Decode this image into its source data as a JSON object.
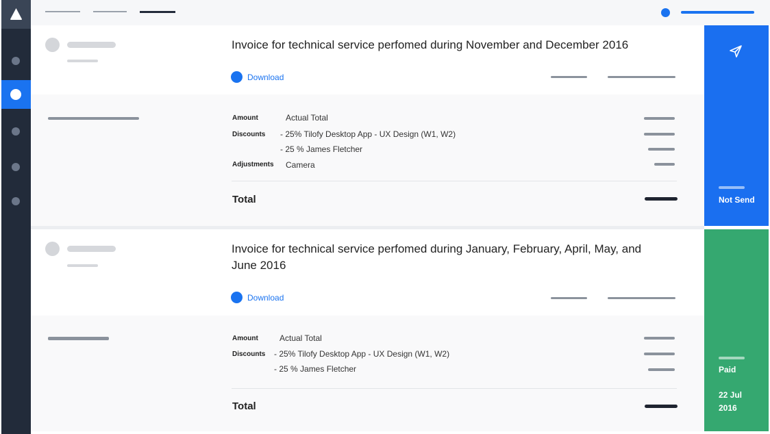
{
  "sidebar": {
    "logo_icon": "triangle-logo",
    "items": [
      {
        "name": "nav-item-1",
        "active": false
      },
      {
        "name": "nav-item-2",
        "active": true
      },
      {
        "name": "nav-item-3",
        "active": false
      },
      {
        "name": "nav-item-4",
        "active": false
      },
      {
        "name": "nav-item-5",
        "active": false
      }
    ]
  },
  "colors": {
    "accent": "#1a73f0",
    "sidebar": "#222b3a",
    "paid": "#35a870",
    "not_sent": "#1a6ff0"
  },
  "invoices": [
    {
      "title": "Invoice for technical service perfomed during November and December 2016",
      "download_label": "Download",
      "rows": [
        {
          "label": "Amount",
          "value": "Actual Total"
        },
        {
          "label": "Discounts",
          "value": "- 25% Tilofy Desktop App - UX Design (W1, W2)"
        },
        {
          "label": "",
          "value": "- 25 % James Fletcher"
        },
        {
          "label": "Adjustments",
          "value": "Camera"
        }
      ],
      "total_label": "Total",
      "status": {
        "label": "Not Send",
        "date": "",
        "icon": "send-icon"
      }
    },
    {
      "title": "Invoice for technical service perfomed during January, February, April, May, and June 2016",
      "download_label": "Download",
      "rows": [
        {
          "label": "Amount",
          "value": "Actual Total"
        },
        {
          "label": "Discounts",
          "value": "- 25% Tilofy Desktop App - UX Design (W1, W2)"
        },
        {
          "label": "",
          "value": "- 25 % James Fletcher"
        }
      ],
      "total_label": "Total",
      "status": {
        "label": "Paid",
        "date": "22 Jul 2016"
      }
    }
  ]
}
